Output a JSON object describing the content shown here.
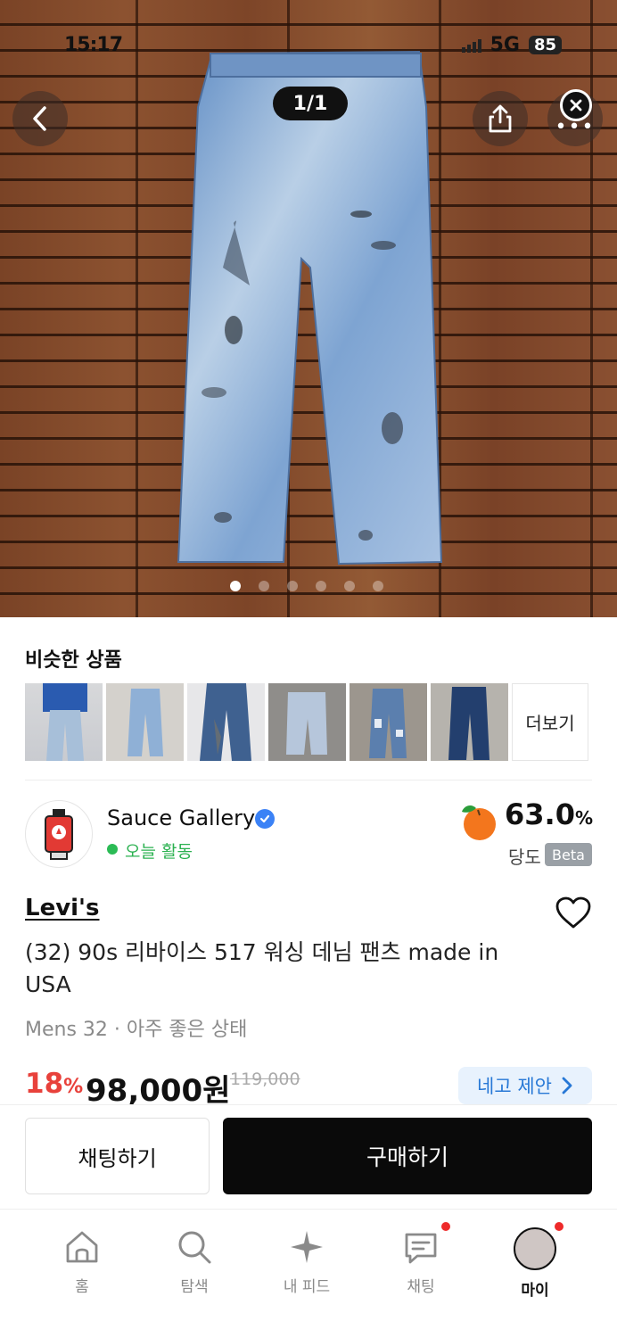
{
  "status_bar": {
    "time": "15:17",
    "network": "5G",
    "battery": "85"
  },
  "image_viewer": {
    "counter": "1/1",
    "dot_count": 6,
    "active_dot": 0
  },
  "similar": {
    "title": "비슷한 상품",
    "more_label": "더보기",
    "thumbnails": [
      "similar-jeans-1",
      "similar-jeans-2",
      "similar-jeans-3",
      "similar-jeans-4",
      "similar-jeans-5",
      "similar-jeans-6"
    ]
  },
  "seller": {
    "name": "Sauce Gallery",
    "activity": "오늘 활동",
    "score": "63.0",
    "score_unit": "%",
    "score_label": "당도",
    "beta": "Beta"
  },
  "product": {
    "brand": "Levi's",
    "title": "(32) 90s 리바이스 517 워싱 데님 팬츠 made in USA",
    "condition": "Mens 32 · 아주 좋은 상태",
    "discount": "18",
    "discount_unit": "%",
    "price": "98,000원",
    "original_price": "119,000",
    "offer_label": "네고 제안"
  },
  "actions": {
    "chat": "채팅하기",
    "buy": "구매하기"
  },
  "tabbar": {
    "items": [
      {
        "label": "홈",
        "icon": "home-icon"
      },
      {
        "label": "탐색",
        "icon": "search-icon"
      },
      {
        "label": "내 피드",
        "icon": "sparkle-icon"
      },
      {
        "label": "채팅",
        "icon": "chat-icon"
      },
      {
        "label": "마이",
        "icon": "profile-avatar"
      }
    ]
  },
  "colors": {
    "accent_blue": "#2778d6",
    "discount_red": "#e8413b",
    "active_green": "#2bb150",
    "badge_red": "#ee2a2a"
  }
}
